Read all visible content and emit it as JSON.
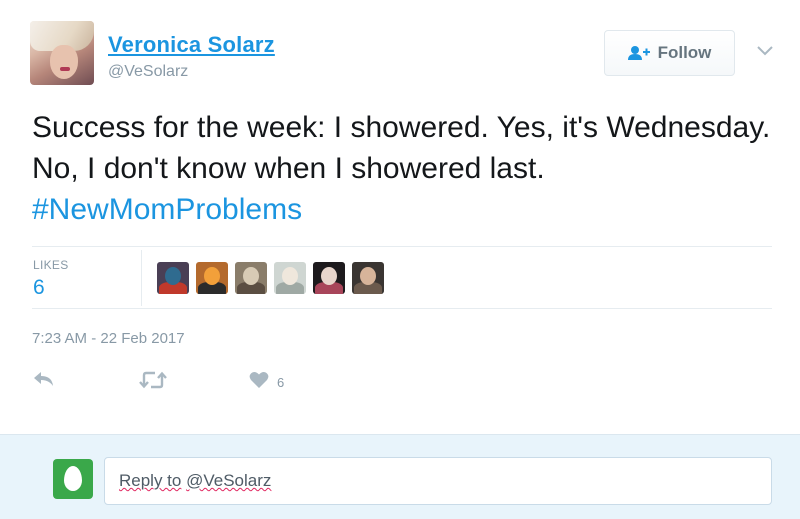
{
  "tweet": {
    "author_name": "Veronica Solarz",
    "author_handle": "@VeSolarz",
    "follow_label": "Follow",
    "text": "Success for the week: I showered. Yes, it's Wednesday. No, I don't know when I showered last.",
    "hashtag": "#NewMomProblems",
    "likes_label": "LIKES",
    "likes_count": "6",
    "timestamp": "7:23 AM - 22 Feb 2017",
    "actions": {
      "reply_icon": "reply-icon",
      "retweet_icon": "retweet-icon",
      "like_icon": "heart-icon",
      "like_count": "6"
    }
  },
  "likers": [
    {
      "name": "liker-avatar-1",
      "colors": [
        "#4a3f55",
        "#2f6b8f",
        "#c0392b"
      ]
    },
    {
      "name": "liker-avatar-2",
      "colors": [
        "#b46a2d",
        "#f2a03a",
        "#2b2b2b"
      ]
    },
    {
      "name": "liker-avatar-3",
      "colors": [
        "#8a7d6a",
        "#d8cbb5",
        "#5b4e42"
      ]
    },
    {
      "name": "liker-avatar-4",
      "colors": [
        "#cfd6d2",
        "#efe7dc",
        "#9fa9a4"
      ]
    },
    {
      "name": "liker-avatar-5",
      "colors": [
        "#1d1a1d",
        "#e8d5cc",
        "#a8455a"
      ]
    },
    {
      "name": "liker-avatar-6",
      "colors": [
        "#3a3532",
        "#d7b49a",
        "#6b5a4d"
      ]
    }
  ],
  "reply": {
    "prefix": "Reply to",
    "target_handle": "@VeSolarz"
  },
  "colors": {
    "link": "#1b95e0",
    "muted": "#8899a6",
    "reply_bg": "#e8f4fb",
    "egg_avatar": "#3aa84a"
  }
}
